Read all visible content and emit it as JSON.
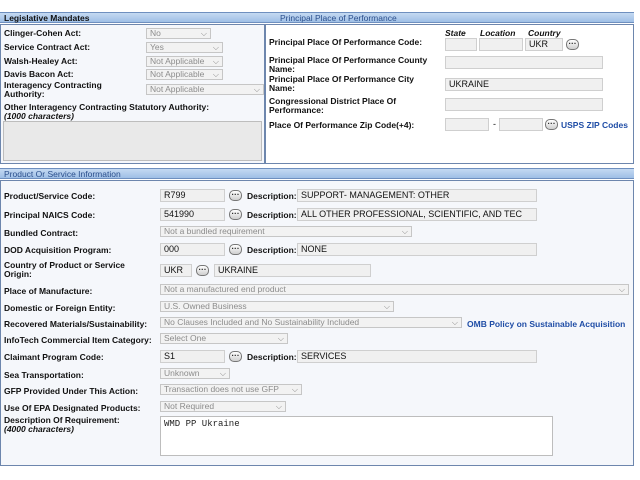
{
  "legislative": {
    "header": "Legislative Mandates",
    "clinger_cohen": {
      "label": "Clinger-Cohen Act:",
      "value": "No"
    },
    "service_contract": {
      "label": "Service Contract Act:",
      "value": "Yes"
    },
    "walsh_healey": {
      "label": "Walsh-Healey Act:",
      "value": "Not Applicable"
    },
    "davis_bacon": {
      "label": "Davis Bacon Act:",
      "value": "Not Applicable"
    },
    "interagency": {
      "label": "Interagency Contracting Authority:",
      "value": "Not Applicable"
    },
    "other_authority": {
      "label": "Other Interagency Contracting Statutory Authority:",
      "hint": "(1000 characters)",
      "value": ""
    }
  },
  "ppop": {
    "header": "Principal Place of Performance",
    "col_state": "State",
    "col_location": "Location",
    "col_country": "Country",
    "code_label": "Principal Place Of Performance Code:",
    "state_value": "",
    "location_value": "",
    "country_value": "UKR",
    "county_label": "Principal Place Of Performance County Name:",
    "county_value": "",
    "city_label": "Principal Place Of Performance City Name:",
    "city_value": "UKRAINE",
    "district_label": "Congressional District Place Of Performance:",
    "district_value": "",
    "zip_label": "Place Of Performance Zip Code(+4):",
    "zip_value": "",
    "zip_ext_value": "",
    "zip_separator": "-",
    "usps_link": "USPS ZIP Codes"
  },
  "product": {
    "header": "Product Or Service Information",
    "desc_label": "Description:",
    "psc": {
      "label": "Product/Service Code:",
      "code": "R799",
      "description": "SUPPORT- MANAGEMENT: OTHER"
    },
    "naics": {
      "label": "Principal NAICS Code:",
      "code": "541990",
      "description": "ALL OTHER PROFESSIONAL, SCIENTIFIC, AND TEC"
    },
    "bundled": {
      "label": "Bundled Contract:",
      "value": "Not a bundled requirement"
    },
    "dod_program": {
      "label": "DOD Acquisition Program:",
      "code": "000",
      "description": "NONE"
    },
    "country_origin": {
      "label": "Country of Product or Service Origin:",
      "code": "UKR",
      "name": "UKRAINE"
    },
    "place_manufacture": {
      "label": "Place of Manufacture:",
      "value": "Not a manufactured end product"
    },
    "domestic_foreign": {
      "label": "Domestic or Foreign Entity:",
      "value": "U.S. Owned Business"
    },
    "recovered": {
      "label": "Recovered Materials/Sustainability:",
      "value": "No Clauses Included and No Sustainability Included"
    },
    "omb_link": "OMB Policy on Sustainable Acquisition",
    "infotech": {
      "label": "InfoTech Commercial Item Category:",
      "value": "Select One"
    },
    "claimant": {
      "label": "Claimant Program Code:",
      "code": "S1",
      "description": "SERVICES"
    },
    "sea_transport": {
      "label": "Sea Transportation:",
      "value": "Unknown"
    },
    "gfp": {
      "label": "GFP Provided Under This Action:",
      "value": "Transaction does not use GFP"
    },
    "epa": {
      "label": "Use Of EPA Designated Products:",
      "value": "Not Required"
    },
    "description_req": {
      "label": "Description Of Requirement:",
      "hint": "(4000 characters)",
      "value": "WMD PP Ukraine"
    }
  },
  "icons": {
    "lookup": "ellipsis-lookup-icon",
    "dropdown": "chevron-down-icon"
  },
  "colors": {
    "header_bg": "#b3cdee",
    "header_text_right": "#2b4f8c",
    "link": "#1f4da6",
    "frame": "#6d86ad"
  }
}
